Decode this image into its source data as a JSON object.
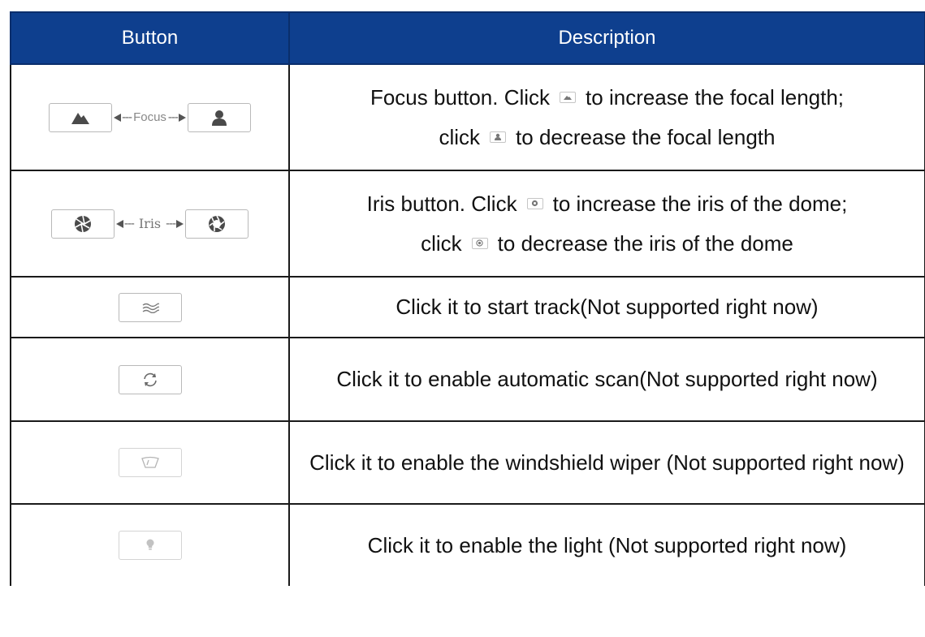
{
  "table": {
    "headers": {
      "button": "Button",
      "description": "Description"
    },
    "rows": [
      {
        "button_label": "Focus",
        "desc_line1_pre": "Focus button. Click",
        "desc_line1_post": "to increase the focal length;",
        "desc_line2_pre": "click",
        "desc_line2_post": "to decrease the focal length"
      },
      {
        "button_label": "Iris",
        "desc_line1_pre": "Iris button. Click",
        "desc_line1_post": "to increase the iris of the dome;",
        "desc_line2_pre": "click",
        "desc_line2_post": "to decrease the iris of the dome"
      },
      {
        "description": "Click it to start track(Not supported right now)"
      },
      {
        "description": "Click it to enable automatic scan(Not supported right now)"
      },
      {
        "description": "Click it to enable the windshield wiper (Not supported right now)"
      },
      {
        "description": "Click it to enable the light (Not supported right now)"
      }
    ]
  },
  "icons": {
    "focus_far": "mountain-icon",
    "focus_near": "person-icon",
    "iris_open": "aperture-open-icon",
    "iris_close": "aperture-close-icon",
    "track": "waves-icon",
    "scan": "refresh-icon",
    "wiper": "wiper-icon",
    "light": "lightbulb-icon"
  },
  "colors": {
    "header_bg": "#0e3f8e",
    "header_text": "#ffffff",
    "border": "#1a1a1a"
  }
}
